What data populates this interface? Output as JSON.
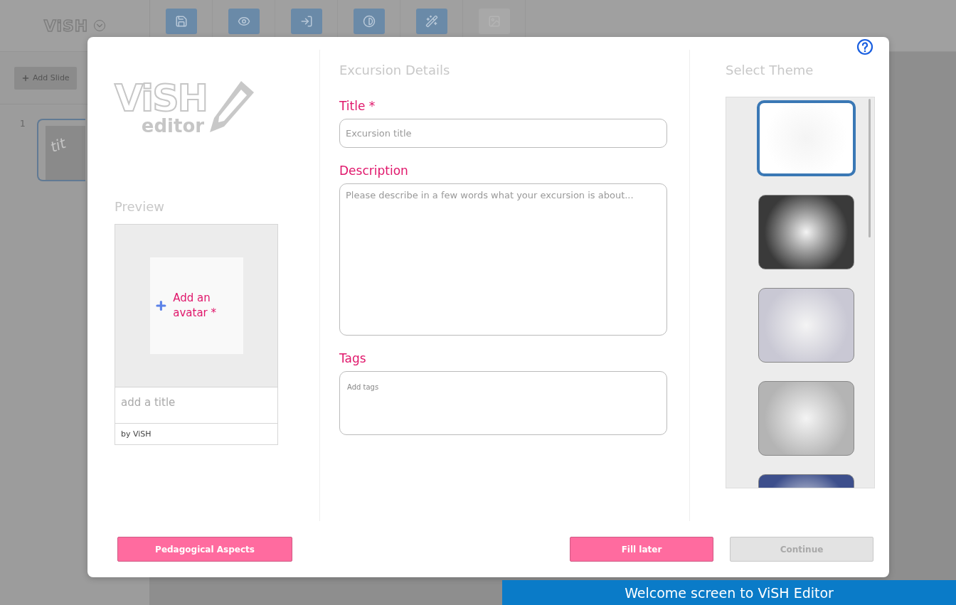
{
  "app": {
    "logo": "ViSH",
    "toolbar": [
      {
        "disabled": false
      },
      {
        "disabled": false
      },
      {
        "disabled": false
      },
      {
        "disabled": false
      },
      {
        "disabled": false
      },
      {
        "disabled": true
      }
    ],
    "add_slide": "Add Slide",
    "slides": [
      {
        "number": "1",
        "thumb_text": "tit",
        "selected": true
      }
    ]
  },
  "dialog": {
    "logo": {
      "wordmark": "ViSH",
      "sub": "editor"
    },
    "preview": {
      "heading": "Preview",
      "avatar_label": "Add an avatar *",
      "title": "add a title",
      "author": "by ViSH"
    },
    "details": {
      "heading": "Excursion Details",
      "fields": [
        {
          "label": "Title *",
          "placeholder": "Excursion title",
          "kind": "input"
        },
        {
          "label": "Description",
          "placeholder": "Please describe in a few words what your excursion is about...",
          "kind": "textarea"
        },
        {
          "label": "Tags",
          "placeholder": "Add tags",
          "kind": "tags"
        }
      ]
    },
    "themes": {
      "heading": "Select Theme",
      "items": [
        {
          "color": "#ffffff",
          "selected": true
        },
        {
          "color": "#3a3a3a",
          "selected": false
        },
        {
          "color": "#c9c8d4",
          "selected": false
        },
        {
          "color": "#b4b4b4",
          "selected": false
        },
        {
          "color": "#3d4f8c",
          "selected": false
        }
      ]
    },
    "buttons": [
      {
        "label": "Pedagogical Aspects",
        "disabled": false
      },
      {
        "label": "Fill later",
        "disabled": false
      },
      {
        "label": "Continue",
        "disabled": true
      }
    ]
  },
  "caption": "Welcome screen to ViSH Editor"
}
